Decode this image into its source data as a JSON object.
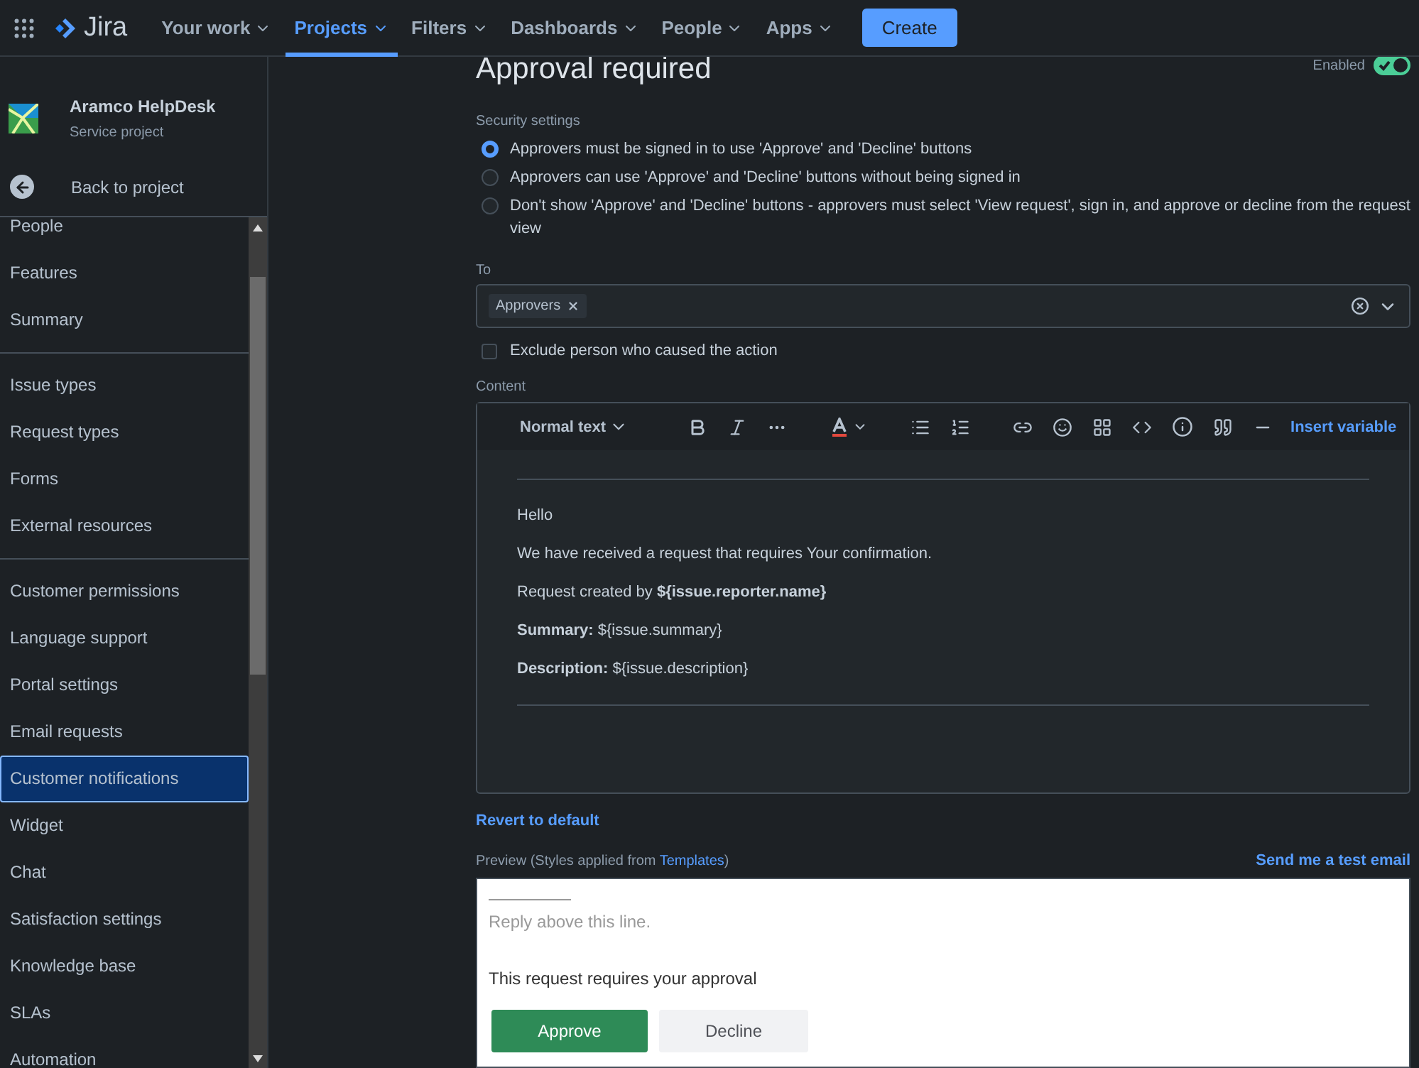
{
  "nav": {
    "product": "Jira",
    "items": [
      {
        "label": "Your work",
        "selected": false
      },
      {
        "label": "Projects",
        "selected": true
      },
      {
        "label": "Filters",
        "selected": false
      },
      {
        "label": "Dashboards",
        "selected": false
      },
      {
        "label": "People",
        "selected": false
      },
      {
        "label": "Apps",
        "selected": false
      }
    ],
    "create": "Create"
  },
  "sidebar": {
    "project_name": "Aramco HelpDesk",
    "project_type": "Service project",
    "back": "Back to project",
    "groups": [
      [
        {
          "label": "People",
          "selected": false
        },
        {
          "label": "Features",
          "selected": false
        },
        {
          "label": "Summary",
          "selected": false
        }
      ],
      [
        {
          "label": "Issue types",
          "selected": false
        },
        {
          "label": "Request types",
          "selected": false
        },
        {
          "label": "Forms",
          "selected": false
        },
        {
          "label": "External resources",
          "selected": false
        }
      ],
      [
        {
          "label": "Customer permissions",
          "selected": false
        },
        {
          "label": "Language support",
          "selected": false
        },
        {
          "label": "Portal settings",
          "selected": false
        },
        {
          "label": "Email requests",
          "selected": false
        },
        {
          "label": "Customer notifications",
          "selected": true
        },
        {
          "label": "Widget",
          "selected": false
        },
        {
          "label": "Chat",
          "selected": false
        },
        {
          "label": "Satisfaction settings",
          "selected": false
        },
        {
          "label": "Knowledge base",
          "selected": false
        },
        {
          "label": "SLAs",
          "selected": false
        },
        {
          "label": "Automation",
          "selected": false
        }
      ]
    ]
  },
  "main": {
    "title": "Approval required",
    "enabled_label": "Enabled",
    "enabled": true,
    "security_label": "Security settings",
    "security_options": [
      {
        "label": "Approvers must be signed in to use 'Approve' and 'Decline' buttons",
        "selected": true
      },
      {
        "label": "Approvers can use 'Approve' and 'Decline' buttons without being signed in",
        "selected": false
      },
      {
        "label": "Don't show 'Approve' and 'Decline' buttons - approvers must select 'View request', sign in, and approve or decline from the request view",
        "selected": false
      }
    ],
    "to_label": "To",
    "to_tags": [
      "Approvers"
    ],
    "exclude": {
      "label": "Exclude person who caused the action",
      "checked": false
    },
    "content_label": "Content",
    "editor": {
      "text_style": "Normal text",
      "insert_variable": "Insert variable",
      "paragraphs": [
        "Hello",
        "We have received a request that requires Your confirmation.",
        "Request created by **${issue.reporter.name}**",
        "**Summary:** ${issue.summary}",
        "**Description:**  ${issue.description}"
      ]
    },
    "revert": "Revert to default",
    "preview_label": {
      "before": "Preview (Styles applied from ",
      "link": "Templates",
      "after": ")"
    },
    "send_test": "Send me a test email",
    "preview": {
      "reply_hint": "Reply above this line.",
      "message": "This request requires your approval",
      "approve": "Approve",
      "decline": "Decline"
    }
  }
}
